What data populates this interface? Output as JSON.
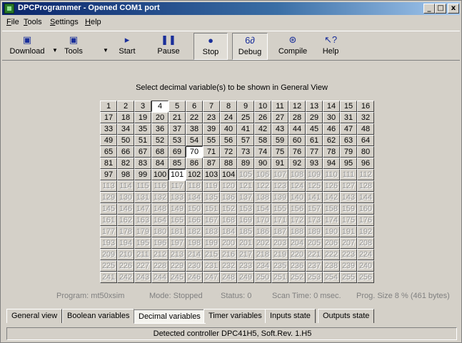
{
  "window": {
    "title": "DPCProgrammer - Opened COM1 port",
    "controls": [
      "_",
      "□",
      "x"
    ]
  },
  "menu": [
    {
      "u": "F",
      "rest": "ile"
    },
    {
      "u": "T",
      "rest": "ools"
    },
    {
      "u": "S",
      "rest": "ettings"
    },
    {
      "u": "H",
      "rest": "elp"
    }
  ],
  "toolbar": {
    "download": "Download",
    "tools": "Tools",
    "start": "Start",
    "pause": "Pause",
    "stop": "Stop",
    "debug": "Debug",
    "compile": "Compile",
    "help": "Help",
    "icons": {
      "download": "▣",
      "tools": "▣",
      "start": "▸",
      "pause": "❚❚",
      "stop": "●",
      "debug": "6∂",
      "compile": "⊛",
      "help": "↖?"
    },
    "dropdown_glyph": "▼"
  },
  "main": {
    "heading": "Select decimal variable(s) to be shown in General View",
    "grid": {
      "count": 256,
      "enabled_max": 104,
      "selected": [
        4,
        70,
        101
      ]
    },
    "status": {
      "program": "Program: mt50xsim",
      "mode": "Mode: Stopped",
      "status": "Status: 0",
      "scan": "Scan Time: 0 msec.",
      "size": "Prog. Size 8 %  (461 bytes)"
    }
  },
  "tabs": [
    "General view",
    "Boolean variables",
    "Decimal variables",
    "Timer variables",
    "Inputs state",
    "Outputs state"
  ],
  "tabs_active": 2,
  "statusbar": {
    "text": "Detected controller DPC41H5, Soft.Rev. 1.H5"
  }
}
